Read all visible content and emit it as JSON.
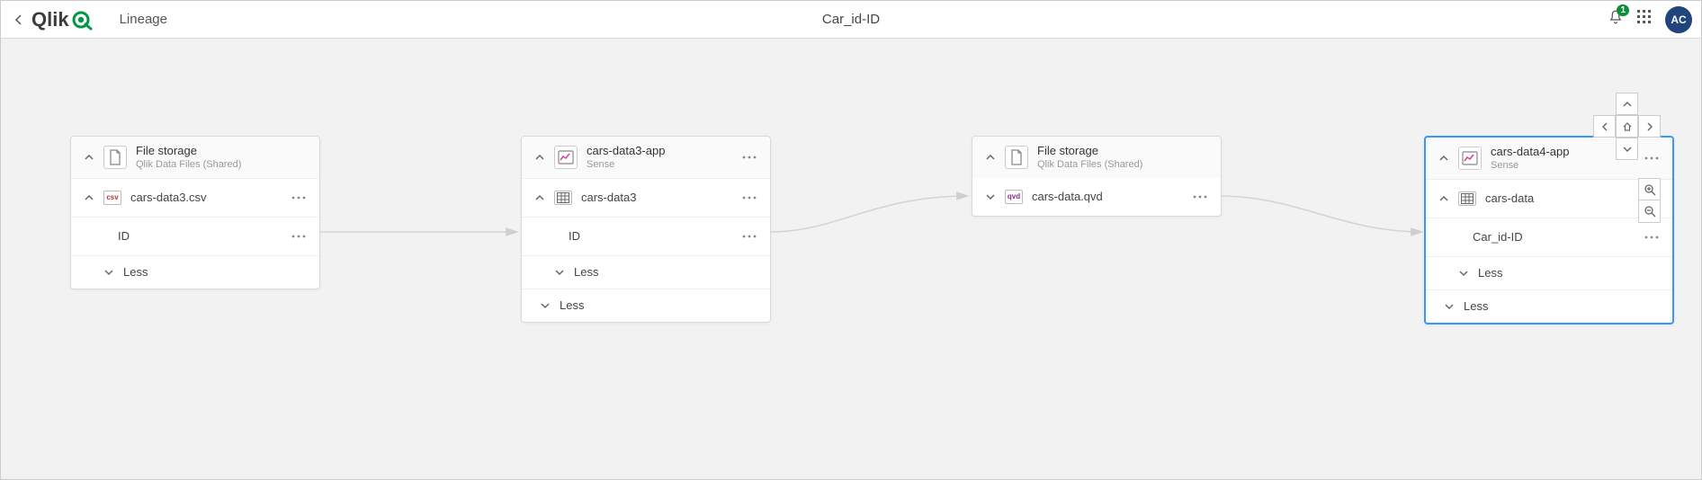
{
  "header": {
    "brand": "Qlik",
    "page": "Lineage",
    "title": "Car_id-ID",
    "notification_count": "1",
    "avatar_initials": "AC"
  },
  "nodes": {
    "n1": {
      "title": "File storage",
      "subtitle": "Qlik Data Files (Shared)",
      "child": {
        "icon_label": "csv",
        "name": "cars-data3.csv",
        "field": "ID",
        "less": "Less"
      }
    },
    "n2": {
      "title": "cars-data3-app",
      "subtitle": "Sense",
      "child": {
        "name": "cars-data3",
        "field": "ID",
        "less": "Less"
      },
      "less_outer": "Less"
    },
    "n3": {
      "title": "File storage",
      "subtitle": "Qlik Data Files (Shared)",
      "child": {
        "icon_label": "qvd",
        "name": "cars-data.qvd"
      }
    },
    "n4": {
      "title": "cars-data4-app",
      "subtitle": "Sense",
      "child": {
        "name": "cars-data",
        "field": "Car_id-ID",
        "less": "Less"
      },
      "less_outer": "Less"
    }
  }
}
